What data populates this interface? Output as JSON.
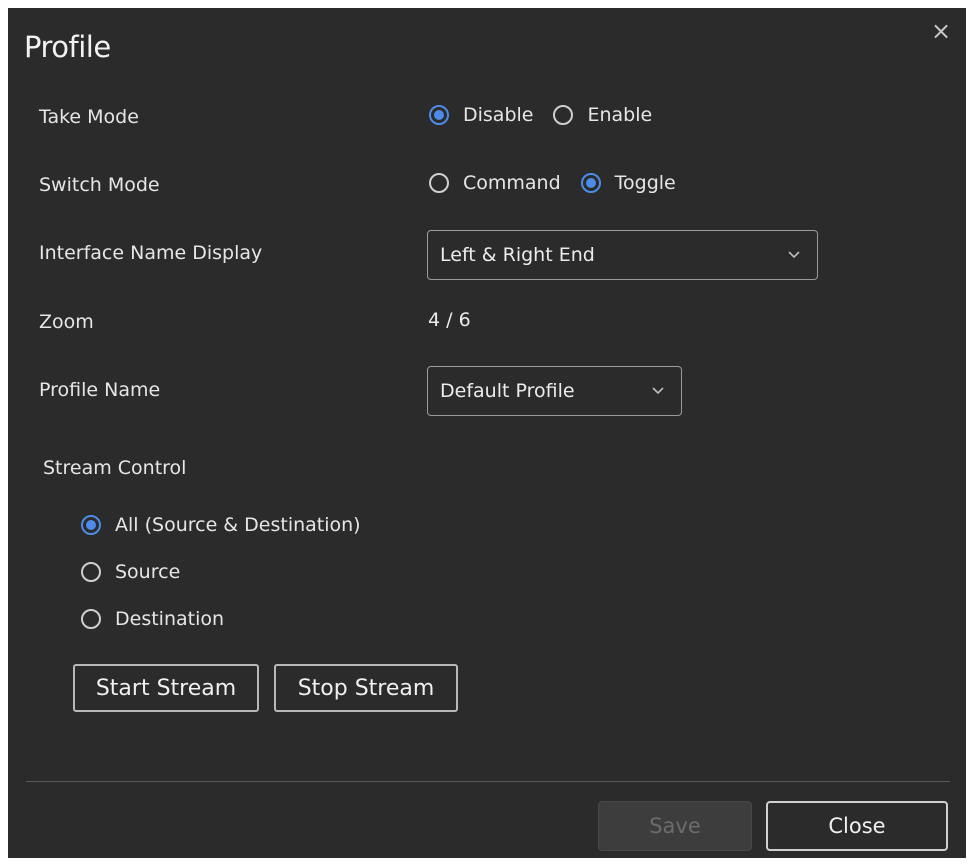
{
  "dialog": {
    "title": "Profile",
    "close_glyph": "×"
  },
  "take_mode": {
    "label": "Take Mode",
    "options": [
      {
        "label": "Disable",
        "checked": true
      },
      {
        "label": "Enable",
        "checked": false
      }
    ]
  },
  "switch_mode": {
    "label": "Switch Mode",
    "options": [
      {
        "label": "Command",
        "checked": false
      },
      {
        "label": "Toggle",
        "checked": true
      }
    ]
  },
  "interface_name_display": {
    "label": "Interface Name Display",
    "selected": "Left & Right End"
  },
  "zoom": {
    "label": "Zoom",
    "value": "4 / 6"
  },
  "profile_name": {
    "label": "Profile Name",
    "selected": "Default Profile"
  },
  "stream_control": {
    "label": "Stream Control",
    "options": [
      {
        "label": "All (Source & Destination)",
        "checked": true
      },
      {
        "label": "Source",
        "checked": false
      },
      {
        "label": "Destination",
        "checked": false
      }
    ],
    "start_label": "Start Stream",
    "stop_label": "Stop Stream"
  },
  "footer": {
    "save_label": "Save",
    "close_label": "Close"
  },
  "colors": {
    "background": "#2b2b2b",
    "accent": "#4c8ce8",
    "text": "#e6e6e6"
  },
  "icons": {
    "close": "close-icon",
    "dropdown": "chevron-down-icon"
  }
}
